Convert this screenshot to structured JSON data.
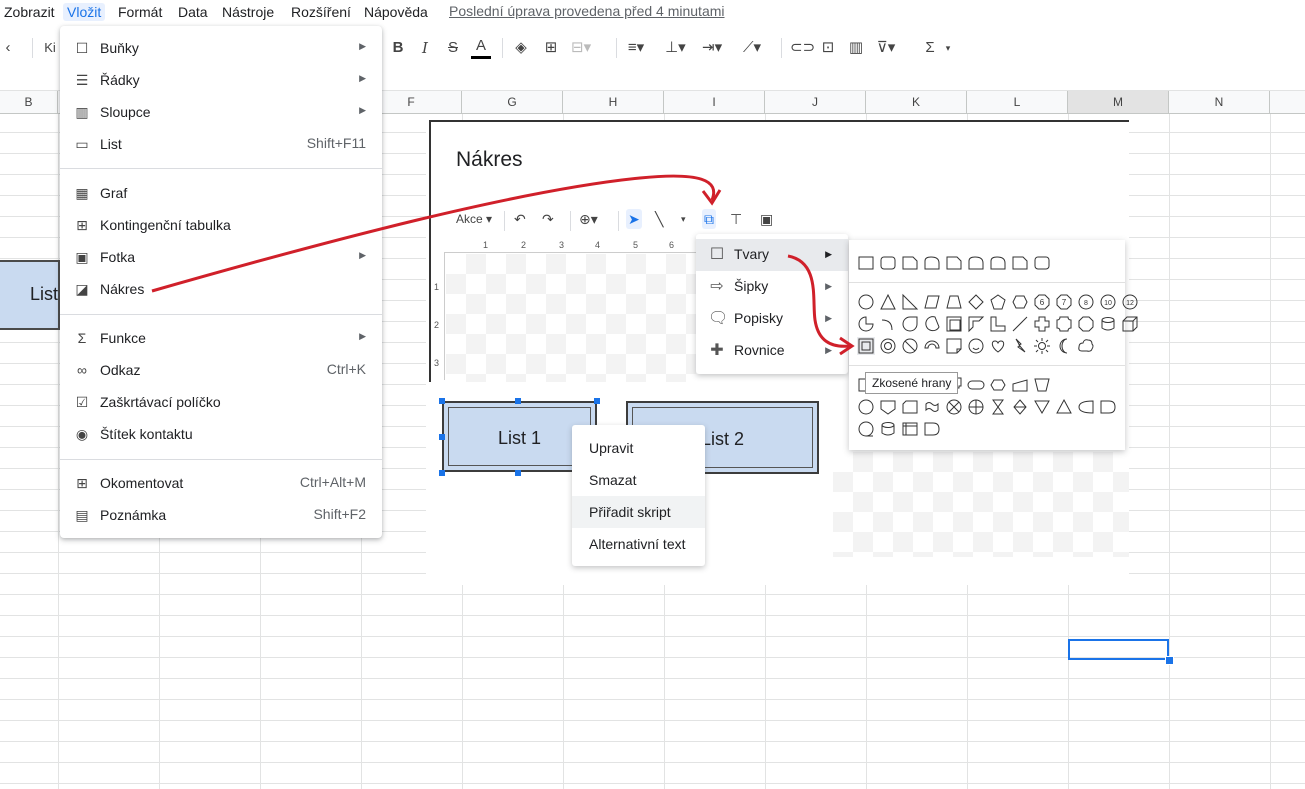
{
  "menubar": {
    "items": [
      "Zobrazit",
      "Vložit",
      "Formát",
      "Data",
      "Nástroje",
      "Rozšíření",
      "Nápověda"
    ],
    "last_edit": "Poslední úprava provedena před 4 minutami"
  },
  "toolbar": {
    "font_name_partial": "Ki",
    "bold": "B",
    "italic": "I",
    "strike": "S",
    "text_color": "A",
    "sum": "Σ"
  },
  "columns": [
    "B",
    "",
    "",
    "",
    "F",
    "G",
    "H",
    "I",
    "J",
    "K",
    "L",
    "M",
    "N"
  ],
  "insert_menu": {
    "groups": [
      [
        {
          "icon": "cells-icon",
          "label": "Buňky",
          "submenu": true
        },
        {
          "icon": "rows-icon",
          "label": "Řádky",
          "submenu": true
        },
        {
          "icon": "columns-icon",
          "label": "Sloupce",
          "submenu": true
        },
        {
          "icon": "sheet-icon",
          "label": "List",
          "shortcut": "Shift+F11"
        }
      ],
      [
        {
          "icon": "chart-icon",
          "label": "Graf"
        },
        {
          "icon": "pivot-table-icon",
          "label": "Kontingenční tabulka"
        },
        {
          "icon": "image-icon",
          "label": "Fotka",
          "submenu": true
        },
        {
          "icon": "drawing-icon",
          "label": "Nákres"
        }
      ],
      [
        {
          "icon": "sigma-icon",
          "label": "Funkce",
          "submenu": true
        },
        {
          "icon": "link-icon",
          "label": "Odkaz",
          "shortcut": "Ctrl+K"
        },
        {
          "icon": "checkbox-icon",
          "label": "Zaškrtávací políčko"
        },
        {
          "icon": "contact-chip-icon",
          "label": "Štítek kontaktu"
        }
      ],
      [
        {
          "icon": "comment-icon",
          "label": "Okomentovat",
          "shortcut": "Ctrl+Alt+M"
        },
        {
          "icon": "note-icon",
          "label": "Poznámka",
          "shortcut": "Shift+F2"
        }
      ]
    ]
  },
  "drawing": {
    "title": "Nákres",
    "actions_label": "Akce",
    "shape_menu": [
      {
        "icon": "square-icon",
        "label": "Tvary"
      },
      {
        "icon": "arrow-icon",
        "label": "Šipky"
      },
      {
        "icon": "callout-icon",
        "label": "Popisky"
      },
      {
        "icon": "plus-icon",
        "label": "Rovnice"
      }
    ],
    "tooltip": "Zkosené hrany",
    "buttons": [
      "List 1",
      "List 2"
    ],
    "left_partial_button": "List",
    "context_menu": [
      "Upravit",
      "Smazat",
      "Přiřadit skript",
      "Alternativní text"
    ],
    "ruler_h_ticks": [
      "1",
      "2",
      "3",
      "4",
      "5",
      "6"
    ],
    "ruler_v_ticks": [
      "1",
      "2",
      "3"
    ]
  },
  "colors": {
    "accent": "#1a73e8",
    "button_fill": "#c9daf0",
    "annotation": "#d0202a"
  }
}
